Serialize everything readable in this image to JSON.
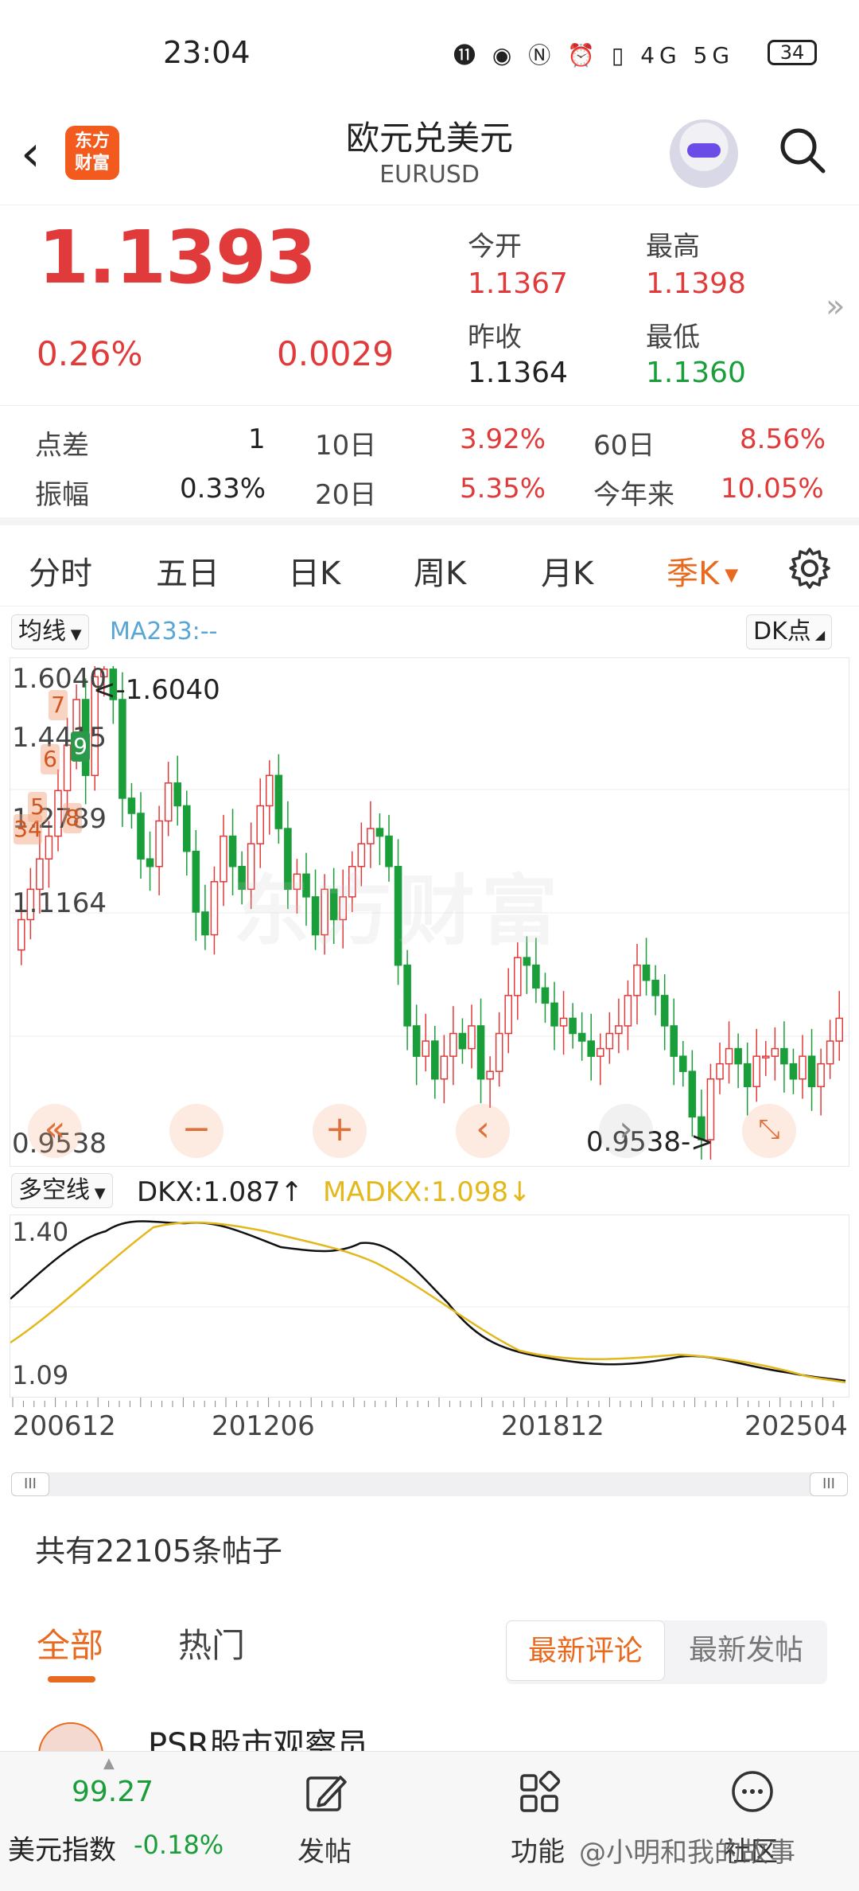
{
  "status": {
    "time": "23:04",
    "icons": "⓫ ◉ Ⓝ ⏰ ▯ 4G 5G",
    "battery": "34"
  },
  "header": {
    "title": "欧元兑美元",
    "subtitle": "EURUSD",
    "logo_text_1": "东方",
    "logo_text_2": "财富"
  },
  "quote": {
    "price": "1.1393",
    "change_pct": "0.26%",
    "change": "0.0029",
    "open_label": "今开",
    "open": "1.1367",
    "high_label": "最高",
    "high": "1.1398",
    "prev_close_label": "昨收",
    "prev_close": "1.1364",
    "low_label": "最低",
    "low": "1.1360"
  },
  "stats": {
    "spread_label": "点差",
    "spread": "1",
    "amp_label": "振幅",
    "amp": "0.33%",
    "d10_label": "10日",
    "d10": "3.92%",
    "d20_label": "20日",
    "d20": "5.35%",
    "d60_label": "60日",
    "d60": "8.56%",
    "ytd_label": "今年来",
    "ytd": "10.05%"
  },
  "tabs": [
    "分时",
    "五日",
    "日K",
    "周K",
    "月K",
    "季K"
  ],
  "indicator": {
    "ma_chip": "均线",
    "ma_label": "MA233:--",
    "dk_chip": "DK点"
  },
  "kchart": {
    "y_labels": [
      "1.6040",
      "1.4415",
      "1.2789",
      "1.1164",
      "0.9538"
    ],
    "high_anno": "<-1.6040",
    "low_anno": "0.9538->",
    "watermark": "东方财富",
    "seq_marks": [
      "34",
      "5",
      "6",
      "7",
      "8",
      "9"
    ]
  },
  "dkx": {
    "chip": "多空线",
    "dkx": "DKX:1.087↑",
    "madkx": "MADKX:1.098↓",
    "y_top": "1.40",
    "y_bottom": "1.09"
  },
  "dates": [
    "200612",
    "201206",
    "201812",
    "202504"
  ],
  "posts": {
    "count_text": "共有22105条帖子",
    "tab_all": "全部",
    "tab_hot": "热门",
    "seg_latest_comment": "最新评论",
    "seg_latest_post": "最新发帖",
    "author": "PSR股市观察员"
  },
  "bottom": {
    "index_value": "99.27",
    "index_name": "美元指数",
    "index_change": "-0.18%",
    "post": "发帖",
    "func": "功能",
    "social": "社区",
    "overlay": "@小明和我的故事"
  },
  "colors": {
    "up": "#e13a3a",
    "down": "#1a9e3a",
    "accent": "#e86a1f",
    "dkx": "#111111",
    "madkx": "#e3b81c"
  }
}
